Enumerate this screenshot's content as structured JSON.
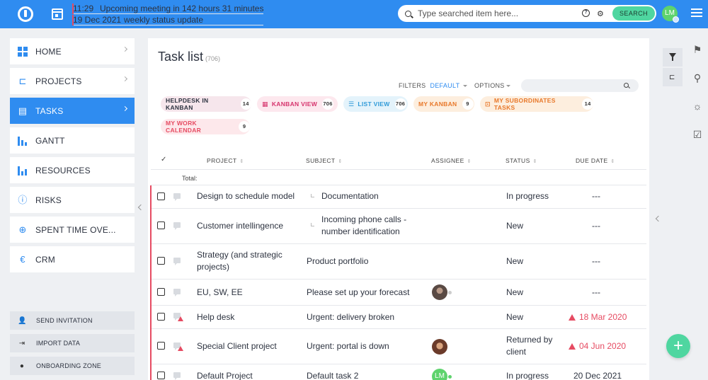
{
  "topbar": {
    "meeting_time": "11:29",
    "meeting_text": "Upcoming meeting in 142 hours 31 minutes",
    "meeting_date": "19 Dec 2021",
    "meeting_title": "weekly status update",
    "search_placeholder": "Type searched item here...",
    "search_button": "SEARCH",
    "user_initials": "LM",
    "accent": "#2f8cf0"
  },
  "sidebar": {
    "items": [
      {
        "label": "HOME",
        "icon": "dashboard-icon"
      },
      {
        "label": "PROJECTS",
        "icon": "project-tree-icon"
      },
      {
        "label": "TASKS",
        "icon": "clipboard-icon",
        "active": true
      },
      {
        "label": "GANTT",
        "icon": "gantt-bars-icon"
      },
      {
        "label": "RESOURCES",
        "icon": "resources-chart-icon"
      },
      {
        "label": "RISKS",
        "icon": "alert-circle-icon"
      },
      {
        "label": "SPENT TIME OVE...",
        "icon": "clock-plus-icon"
      },
      {
        "label": "CRM",
        "icon": "euro-icon"
      }
    ],
    "actions": [
      {
        "label": "SEND INVITATION",
        "icon": "add-user-icon"
      },
      {
        "label": "IMPORT DATA",
        "icon": "import-icon"
      },
      {
        "label": "ONBOARDING ZONE",
        "icon": "info-icon"
      }
    ]
  },
  "main": {
    "title": "Task list",
    "count": "(706)",
    "filters_label": "FILTERS",
    "filters_value": "DEFAULT",
    "options_label": "OPTIONS",
    "chips": [
      {
        "label": "HELPDESK IN KANBAN",
        "count": "14",
        "color": "#2d3340",
        "bg": "#f6e6ec"
      },
      {
        "label": "KANBAN VIEW",
        "count": "706",
        "color": "#d6336c",
        "bg": "#fde8ee"
      },
      {
        "label": "LIST VIEW",
        "count": "706",
        "color": "#2f9ad8",
        "bg": "#e4f3fb"
      },
      {
        "label": "MY KANBAN",
        "count": "9",
        "color": "#e8782a",
        "bg": "#fdeede"
      },
      {
        "label": "MY SUBORDINATES TASKS",
        "count": "14",
        "color": "#e8782a",
        "bg": "#fdeede"
      },
      {
        "label": "MY WORK CALENDAR",
        "count": "9",
        "color": "#e64b62",
        "bg": "#fde8eb"
      }
    ],
    "table": {
      "columns": {
        "check": "✓",
        "project": "PROJECT",
        "subject": "SUBJECT",
        "assignee": "ASSIGNEE",
        "status": "STATUS",
        "due": "DUE DATE"
      },
      "total_label": "Total:",
      "rows": [
        {
          "project": "Design to schedule model",
          "subject": "Documentation",
          "subtask": true,
          "status": "In progress",
          "due": "---"
        },
        {
          "project": "Customer intellingence",
          "subject": "Incoming phone calls - number identification",
          "subtask": true,
          "status": "New",
          "due": "---"
        },
        {
          "project": "Strategy (and strategic projects)",
          "subject": "Product portfolio",
          "status": "New",
          "due": "---"
        },
        {
          "project": "EU, SW, EE",
          "subject": "Please set up your forecast",
          "assignee": "photo",
          "status": "New",
          "due": "---"
        },
        {
          "project": "Help desk",
          "subject": "Urgent: delivery broken",
          "status": "New",
          "due": "18 Mar 2020",
          "overdue": true,
          "urgent": true
        },
        {
          "project": "Special Client project",
          "subject": "Urgent: portal is down",
          "assignee": "photo",
          "status": "Returned by client",
          "due": "04 Jun 2020",
          "overdue": true,
          "urgent": true
        },
        {
          "project": "Default Project",
          "subject": "Default task 2",
          "assignee": "LM",
          "status": "In progress",
          "due": "20 Dec 2021"
        }
      ]
    }
  }
}
